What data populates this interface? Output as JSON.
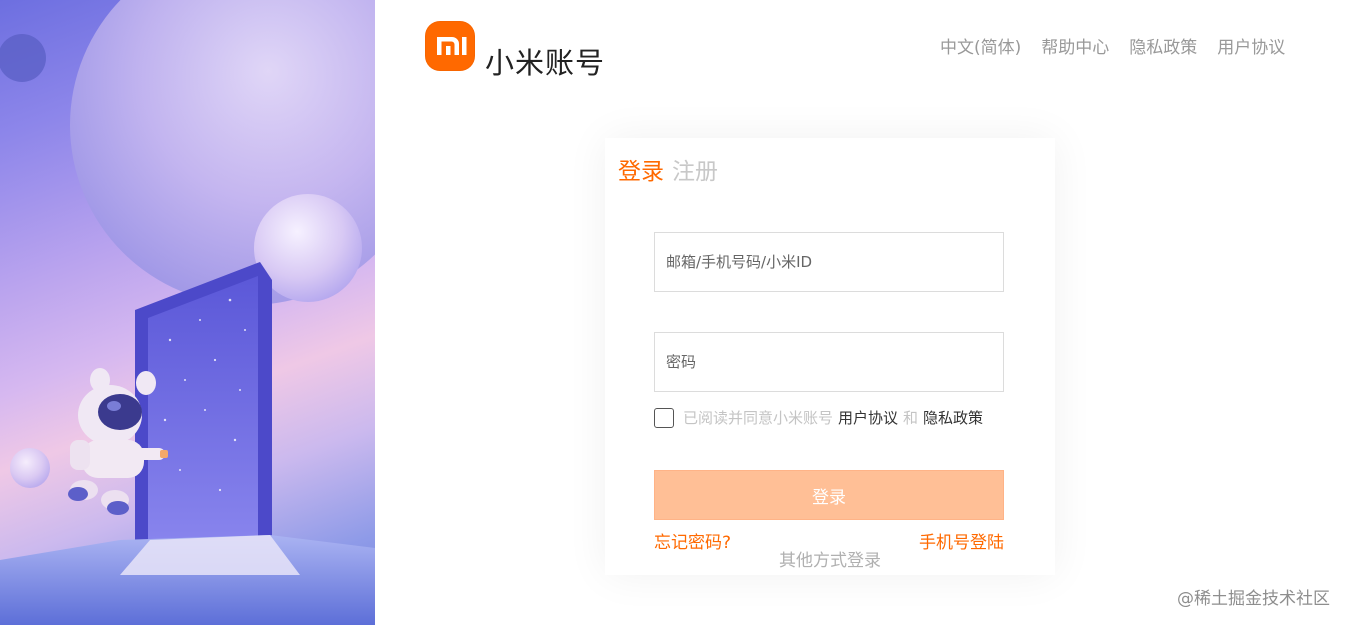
{
  "header": {
    "logo_text": "mi",
    "brand": "小米账号",
    "nav": [
      {
        "label": "中文(简体)"
      },
      {
        "label": "帮助中心"
      },
      {
        "label": "隐私政策"
      },
      {
        "label": "用户协议"
      }
    ]
  },
  "tabs": [
    {
      "label": "登录",
      "active": true
    },
    {
      "label": "注册",
      "active": false
    }
  ],
  "form": {
    "username": {
      "value": "",
      "placeholder": "邮箱/手机号码/小米ID"
    },
    "password": {
      "value": "",
      "placeholder": "密码"
    },
    "agree": {
      "checked": false,
      "prefix": "已阅读并同意小米账号",
      "user_agreement": "用户协议",
      "and": "和",
      "privacy_policy": "隐私政策"
    },
    "submit_label": "登录",
    "forgot_label": "忘记密码?",
    "phone_login_label": "手机号登陆",
    "other_methods_label": "其他方式登录"
  },
  "watermark": "@稀土掘金技术社区",
  "colors": {
    "accent": "#ff6900",
    "button_disabled": "#ffbf96",
    "muted_text": "#999999"
  }
}
